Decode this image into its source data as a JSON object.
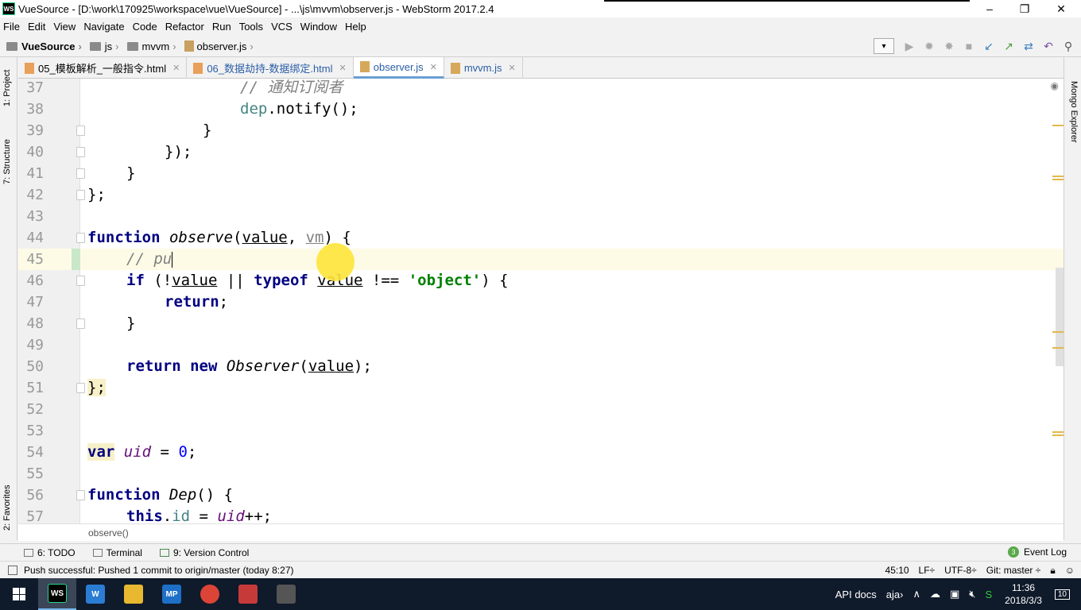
{
  "window": {
    "title": "VueSource - [D:\\work\\170925\\workspace\\vue\\VueSource] - ...\\js\\mvvm\\observer.js - WebStorm 2017.2.4",
    "app_icon": "WS"
  },
  "menu": [
    "File",
    "Edit",
    "View",
    "Navigate",
    "Code",
    "Refactor",
    "Run",
    "Tools",
    "VCS",
    "Window",
    "Help"
  ],
  "breadcrumbs": [
    "VueSource",
    "js",
    "mvvm",
    "observer.js"
  ],
  "tool_windows_left": {
    "project": "1: Project",
    "structure": "7: Structure",
    "favorites": "2: Favorites"
  },
  "tool_windows_right": {
    "mongo": "Mongo Explorer"
  },
  "tabs": [
    {
      "label": "05_模板解析_一般指令.html",
      "type": "html",
      "active": false
    },
    {
      "label": "06_数据劫持-数据绑定.html",
      "type": "html",
      "active": false
    },
    {
      "label": "observer.js",
      "type": "js",
      "active": true
    },
    {
      "label": "mvvm.js",
      "type": "js",
      "active": false
    }
  ],
  "code": {
    "line_numbers": [
      "37",
      "38",
      "39",
      "40",
      "41",
      "42",
      "43",
      "44",
      "45",
      "46",
      "47",
      "48",
      "49",
      "50",
      "51",
      "52",
      "53",
      "54",
      "55",
      "56",
      "57"
    ],
    "l37": "// 通知订阅者",
    "l38a": "dep",
    "l38b": ".notify();",
    "l39": "}",
    "l40": "});",
    "l41": "}",
    "l42": "};",
    "l44": {
      "kw": "function",
      "name": "observe",
      "p1": "value",
      "p2": "vm",
      "tail": ") {"
    },
    "l45": "// pu",
    "l46": {
      "kw1": "if",
      "v1": "value",
      "kw2": "typeof",
      "v2": "value",
      "str": "'object'"
    },
    "l47": "return",
    "l48": "}",
    "l50": {
      "kw1": "return",
      "kw2": "new",
      "cls": "Observer",
      "arg": "value"
    },
    "l51": "};",
    "l54": {
      "kw": "var",
      "name": "uid",
      "num": "0"
    },
    "l56": {
      "kw": "function",
      "name": "Dep"
    },
    "l57": {
      "kw": "this",
      "prop": "id",
      "name": "uid"
    }
  },
  "editor_breadcrumb": "observe()",
  "bottom_tools": [
    "6: TODO",
    "Terminal",
    "9: Version Control"
  ],
  "event_log": {
    "label": "Event Log",
    "count": "3"
  },
  "status": {
    "message": "Push successful: Pushed 1 commit to origin/master (today 8:27)",
    "position": "45:10",
    "line_sep": "LF÷",
    "encoding": "UTF-8÷",
    "git": "Git: master ÷"
  },
  "taskbar": {
    "tray_text": "API docs",
    "tray_ime": "aja›",
    "time": "11:36",
    "date": "2018/3/3",
    "notif_count": "10"
  },
  "colors": {
    "accent": "#6a9fd3",
    "highlight": "#fde43a",
    "taskbar": "#0f1a2a"
  }
}
